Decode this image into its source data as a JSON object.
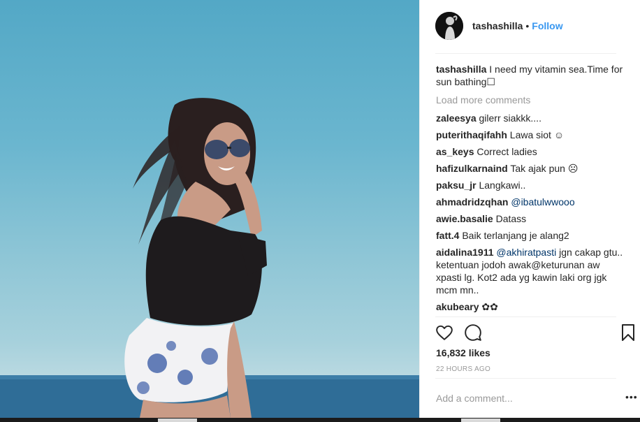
{
  "post": {
    "username": "tashashilla",
    "follow_label": "Follow",
    "separator": "•",
    "caption_text": "I need my vitamin sea.Time for sun bathing☐",
    "load_more": "Load more comments",
    "comments": [
      {
        "user": "zaleesya",
        "text": "gilerr siakkk...."
      },
      {
        "user": "puterithaqifahh",
        "text": "Lawa siot ☺"
      },
      {
        "user": "as_keys",
        "text": "Correct ladies"
      },
      {
        "user": "hafizulkarnaind",
        "text": "Tak ajak pun ☹"
      },
      {
        "user": "paksu_jr",
        "text": "Langkawi.."
      },
      {
        "user": "ahmadridzqhan",
        "text": "",
        "mention": "@ibatulwwooo"
      },
      {
        "user": "awie.basalie",
        "text": "Datass"
      },
      {
        "user": "fatt.4",
        "text": "Baik terlanjang je alang2"
      },
      {
        "user": "aidalina1911",
        "mention": "@akhiratpasti",
        "text": "jgn cakap gtu.. ketentuan jodoh awak@keturunan aw xpasti lg. Kot2 ada yg kawin laki org jgk mcm mn.."
      },
      {
        "user": "akubeary",
        "text": "✿✿"
      }
    ],
    "likes": "16,832 likes",
    "time_ago": "22 HOURS AGO",
    "add_comment_placeholder": "Add a comment...",
    "more_options": "•••"
  },
  "icons": {
    "like": "heart-outline-icon",
    "comment": "speech-bubble-icon",
    "save": "bookmark-icon",
    "more": "ellipsis-icon"
  },
  "colors": {
    "link": "#3897f0",
    "mention": "#003569",
    "muted": "#999999",
    "sky": "#6bb6cf",
    "sea": "#2f6d97"
  }
}
